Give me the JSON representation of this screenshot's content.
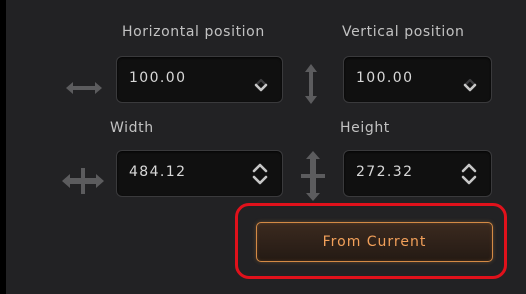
{
  "position": {
    "horizontal_label": "Horizontal position",
    "horizontal_value": "100.00",
    "vertical_label": "Vertical position",
    "vertical_value": "100.00"
  },
  "size": {
    "width_label": "Width",
    "width_value": "484.12",
    "height_label": "Height",
    "height_value": "272.32"
  },
  "actions": {
    "from_current_label": "From Current"
  },
  "colors": {
    "panel_bg": "#222224",
    "accent": "#f2a05a",
    "highlight": "#e0111b"
  },
  "icons": {
    "horizontal": "horizontal-arrows-icon",
    "vertical": "vertical-arrows-icon",
    "width": "width-arrows-icon",
    "height": "height-arrows-icon",
    "stepper_down": "chevron-down-icon",
    "stepper_updown": "chevron-up-down-icon"
  }
}
